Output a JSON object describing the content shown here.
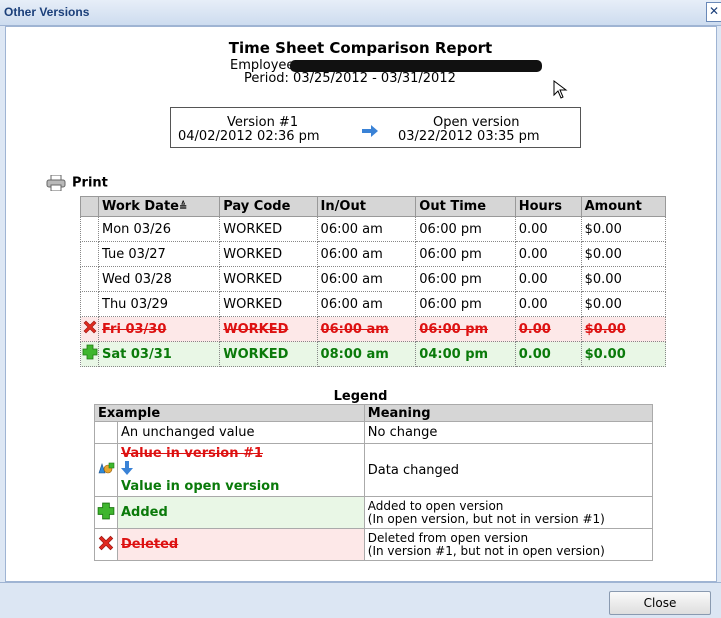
{
  "window": {
    "title": "Other Versions",
    "close_glyph": "✕"
  },
  "report": {
    "title": "Time Sheet Comparison Report",
    "employee_label": "Employee:",
    "period": "Period: 03/25/2012 - 03/31/2012"
  },
  "versions": {
    "left_label": "Version #1",
    "left_date": "04/02/2012 02:36 pm",
    "right_label": "Open version",
    "right_date": "03/22/2012 03:35 pm",
    "arrow_icon": "arrow-right-icon"
  },
  "print": {
    "label": "Print",
    "icon": "printer-icon"
  },
  "timesheet": {
    "headers": [
      "Work Date",
      "Pay Code",
      "In/Out",
      "Out Time",
      "Hours",
      "Amount"
    ],
    "sort_indicator": "≜",
    "rows": [
      {
        "status": "unchanged",
        "cells": [
          "Mon 03/26",
          "WORKED",
          "06:00 am",
          "06:00 pm",
          "0.00",
          "$0.00"
        ]
      },
      {
        "status": "unchanged",
        "cells": [
          "Tue 03/27",
          "WORKED",
          "06:00 am",
          "06:00 pm",
          "0.00",
          "$0.00"
        ]
      },
      {
        "status": "unchanged",
        "cells": [
          "Wed 03/28",
          "WORKED",
          "06:00 am",
          "06:00 pm",
          "0.00",
          "$0.00"
        ]
      },
      {
        "status": "unchanged",
        "cells": [
          "Thu 03/29",
          "WORKED",
          "06:00 am",
          "06:00 pm",
          "0.00",
          "$0.00"
        ]
      },
      {
        "status": "deleted",
        "icon": "delete-x-icon",
        "cells": [
          "Fri 03/30",
          "WORKED",
          "06:00 am",
          "06:00 pm",
          "0.00",
          "$0.00"
        ]
      },
      {
        "status": "added",
        "icon": "add-plus-icon",
        "cells": [
          "Sat 03/31",
          "WORKED",
          "08:00 am",
          "04:00 pm",
          "0.00",
          "$0.00"
        ]
      }
    ]
  },
  "legend": {
    "title": "Legend",
    "headers": [
      "Example",
      "Meaning"
    ],
    "rows": [
      {
        "example": "An unchanged value",
        "meaning": "No change"
      },
      {
        "example_old": "Value in version #1",
        "example_new": "Value in open version",
        "icon": "changed-icon",
        "arrow_icon": "arrow-down-icon",
        "meaning": "Data changed"
      },
      {
        "example": "Added",
        "icon": "add-plus-icon",
        "meaning_line1": "Added to open version",
        "meaning_line2": "(In open version, but not in version #1)"
      },
      {
        "example": "Deleted",
        "icon": "delete-x-icon",
        "meaning_line1": "Deleted from open version",
        "meaning_line2": "(In version #1, but not in open version)"
      }
    ]
  },
  "footer": {
    "close_label": "Close"
  },
  "colors": {
    "added": "#0a7a0a",
    "deleted": "#d11111",
    "header_bg": "#d6d6d6",
    "title_text": "#1b3f7a"
  }
}
